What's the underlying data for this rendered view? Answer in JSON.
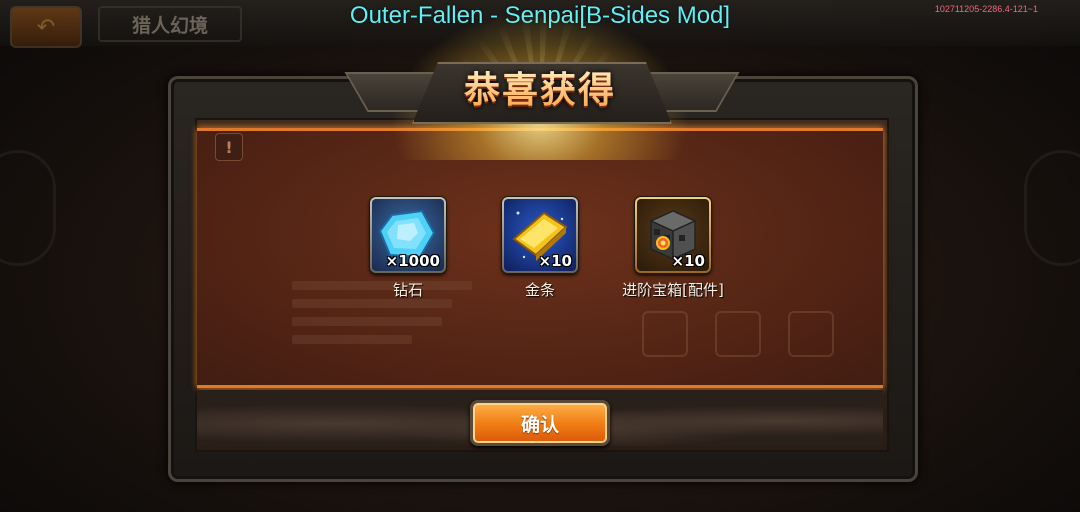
{
  "overlay": {
    "mod_title": "Outer-Fallen - Senpai[B-Sides Mod]",
    "version": "102711205-2286.4-121~1"
  },
  "background": {
    "screen_title": "猎人幻境",
    "back_icon": "back-arrow-icon"
  },
  "dialog": {
    "title": "恭喜获得",
    "confirm_label": "确认",
    "rewards": [
      {
        "name": "钻石",
        "quantity": "×1000",
        "icon": "diamond-icon",
        "color": "#3cc4f2"
      },
      {
        "name": "金条",
        "quantity": "×10",
        "icon": "gold-bar-icon",
        "color": "#f5c21a"
      },
      {
        "name": "进阶宝箱[配件]",
        "quantity": "×10",
        "icon": "treasure-chest-icon",
        "color": "#5a5a5a"
      }
    ]
  },
  "colors": {
    "accent_orange": "#f07a12",
    "overlay_cyan": "#5ff0f5",
    "panel_border": "#e07a2a"
  }
}
